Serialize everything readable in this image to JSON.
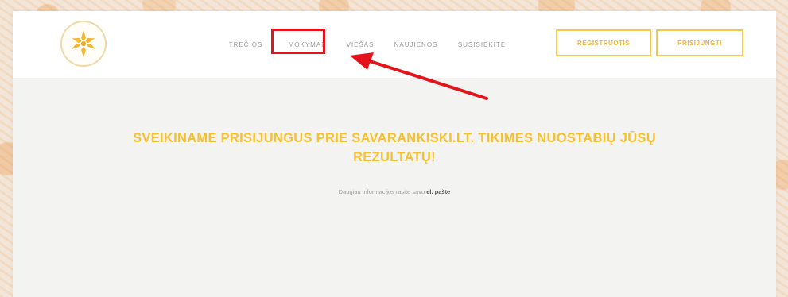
{
  "header": {
    "logo_icon": "sun-flower-logo-icon",
    "nav_items": [
      {
        "label": "TREČIOS"
      },
      {
        "label": "MOKYMAI"
      },
      {
        "label": "VIEŠAS"
      },
      {
        "label": "NAUJIENOS"
      },
      {
        "label": "SUSISIEKITE"
      }
    ],
    "register_label": "REGISTRUOTIS",
    "login_label": "PRISIJUNGTI"
  },
  "annotation": {
    "highlight_color": "#e3141b",
    "arrow_color": "#e3141b"
  },
  "main": {
    "welcome_line1": "SVEIKINAME PRISIJUNGUS PRIE SAVARANKISKI.LT. TIKIMES NUOSTABIŲ JŪSŲ",
    "welcome_line2": "REZULTATŲ!",
    "info_text": "Daugiau informacijos rasite savo",
    "info_link": "el. pašte"
  },
  "colors": {
    "accent_yellow": "#f6c12f",
    "button_border": "#f4c84a",
    "background_orange": "#eaa05a"
  }
}
